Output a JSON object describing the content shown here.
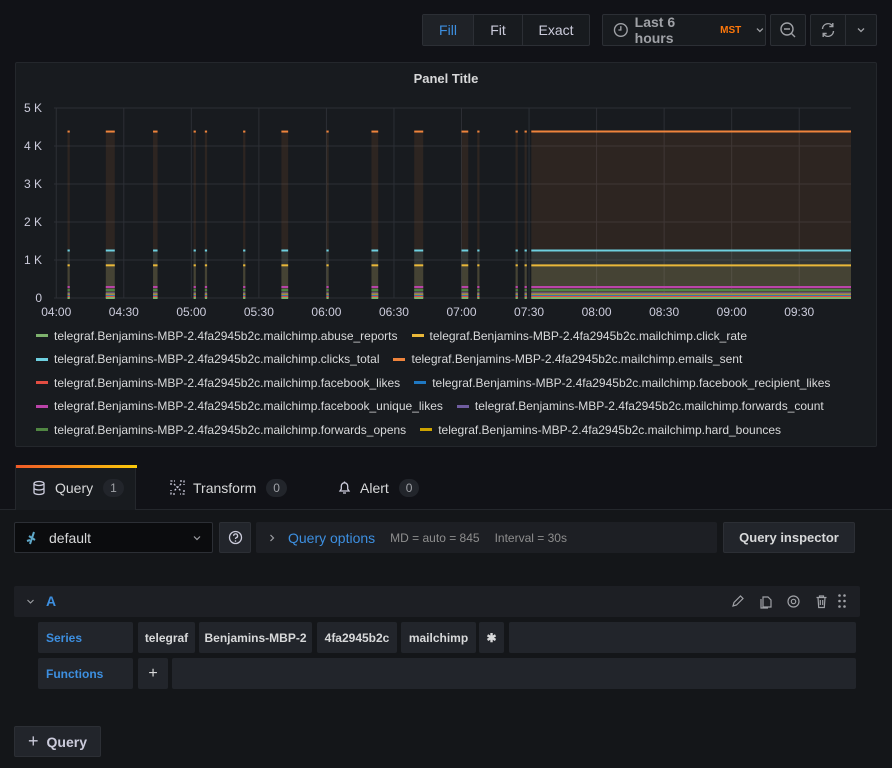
{
  "toolbar": {
    "fill": "Fill",
    "fit": "Fit",
    "exact": "Exact",
    "time_range": "Last 6 hours",
    "timezone": "MST",
    "icons": [
      "clock-icon",
      "chevron-down-icon",
      "zoom-out-icon",
      "refresh-icon",
      "chevron-down-icon"
    ]
  },
  "panel": {
    "title": "Panel Title"
  },
  "chart_data": {
    "type": "area",
    "title": "Panel Title",
    "y_ticks": [
      "0",
      "1 K",
      "2 K",
      "3 K",
      "4 K",
      "5 K"
    ],
    "ylim": [
      0,
      5000
    ],
    "x_ticks": [
      "04:00",
      "04:30",
      "05:00",
      "05:30",
      "06:00",
      "06:30",
      "07:00",
      "07:30",
      "08:00",
      "08:30",
      "09:00",
      "09:30"
    ],
    "xlim": [
      "03:59",
      "09:53"
    ],
    "grid": true,
    "legend_placement": "bottom",
    "data_intervals": [
      [
        "04:05",
        "04:06"
      ],
      [
        "04:22",
        "04:26"
      ],
      [
        "04:43",
        "04:45"
      ],
      [
        "05:01",
        "05:02"
      ],
      [
        "05:06",
        "05:07"
      ],
      [
        "05:23",
        "05:24"
      ],
      [
        "05:40",
        "05:43"
      ],
      [
        "06:00",
        "06:01"
      ],
      [
        "06:20",
        "06:23"
      ],
      [
        "06:39",
        "06:43"
      ],
      [
        "07:00",
        "07:03"
      ],
      [
        "07:07",
        "07:08"
      ],
      [
        "07:24",
        "07:25"
      ],
      [
        "07:28",
        "07:29"
      ],
      [
        "07:31",
        "09:53"
      ]
    ],
    "series": [
      {
        "name": "telegraf.Benjamins-MBP-2.4fa2945b2c.mailchimp.abuse_reports",
        "color": "#7eb26d",
        "value": 0
      },
      {
        "name": "telegraf.Benjamins-MBP-2.4fa2945b2c.mailchimp.click_rate",
        "color": "#eab839",
        "value": 860
      },
      {
        "name": "telegraf.Benjamins-MBP-2.4fa2945b2c.mailchimp.clicks_total",
        "color": "#6ed0e0",
        "value": 1250
      },
      {
        "name": "telegraf.Benjamins-MBP-2.4fa2945b2c.mailchimp.emails_sent",
        "color": "#ef843c",
        "value": 4380
      },
      {
        "name": "telegraf.Benjamins-MBP-2.4fa2945b2c.mailchimp.facebook_likes",
        "color": "#e24d42",
        "value": 30
      },
      {
        "name": "telegraf.Benjamins-MBP-2.4fa2945b2c.mailchimp.facebook_recipient_likes",
        "color": "#1f78c1",
        "value": 60
      },
      {
        "name": "telegraf.Benjamins-MBP-2.4fa2945b2c.mailchimp.facebook_unique_likes",
        "color": "#ba43a9",
        "value": 290
      },
      {
        "name": "telegraf.Benjamins-MBP-2.4fa2945b2c.mailchimp.forwards_count",
        "color": "#705da0",
        "value": 120
      },
      {
        "name": "telegraf.Benjamins-MBP-2.4fa2945b2c.mailchimp.forwards_opens",
        "color": "#508642",
        "value": 210
      },
      {
        "name": "telegraf.Benjamins-MBP-2.4fa2945b2c.mailchimp.hard_bounces",
        "color": "#cca300",
        "value": 90
      }
    ]
  },
  "tabs": [
    {
      "label": "Query",
      "count": "1"
    },
    {
      "label": "Transform",
      "count": "0"
    },
    {
      "label": "Alert",
      "count": "0"
    }
  ],
  "datasource": {
    "name": "default"
  },
  "query_options": {
    "label": "Query options",
    "md": "MD = auto = 845",
    "interval": "Interval = 30s"
  },
  "query_inspector": "Query inspector",
  "query": {
    "ref": "A",
    "series_label": "Series",
    "segments": [
      "telegraf",
      "Benjamins-MBP-2",
      "4fa2945b2c",
      "mailchimp",
      "✱"
    ],
    "functions_label": "Functions",
    "add": "+"
  },
  "add_query": "Query"
}
